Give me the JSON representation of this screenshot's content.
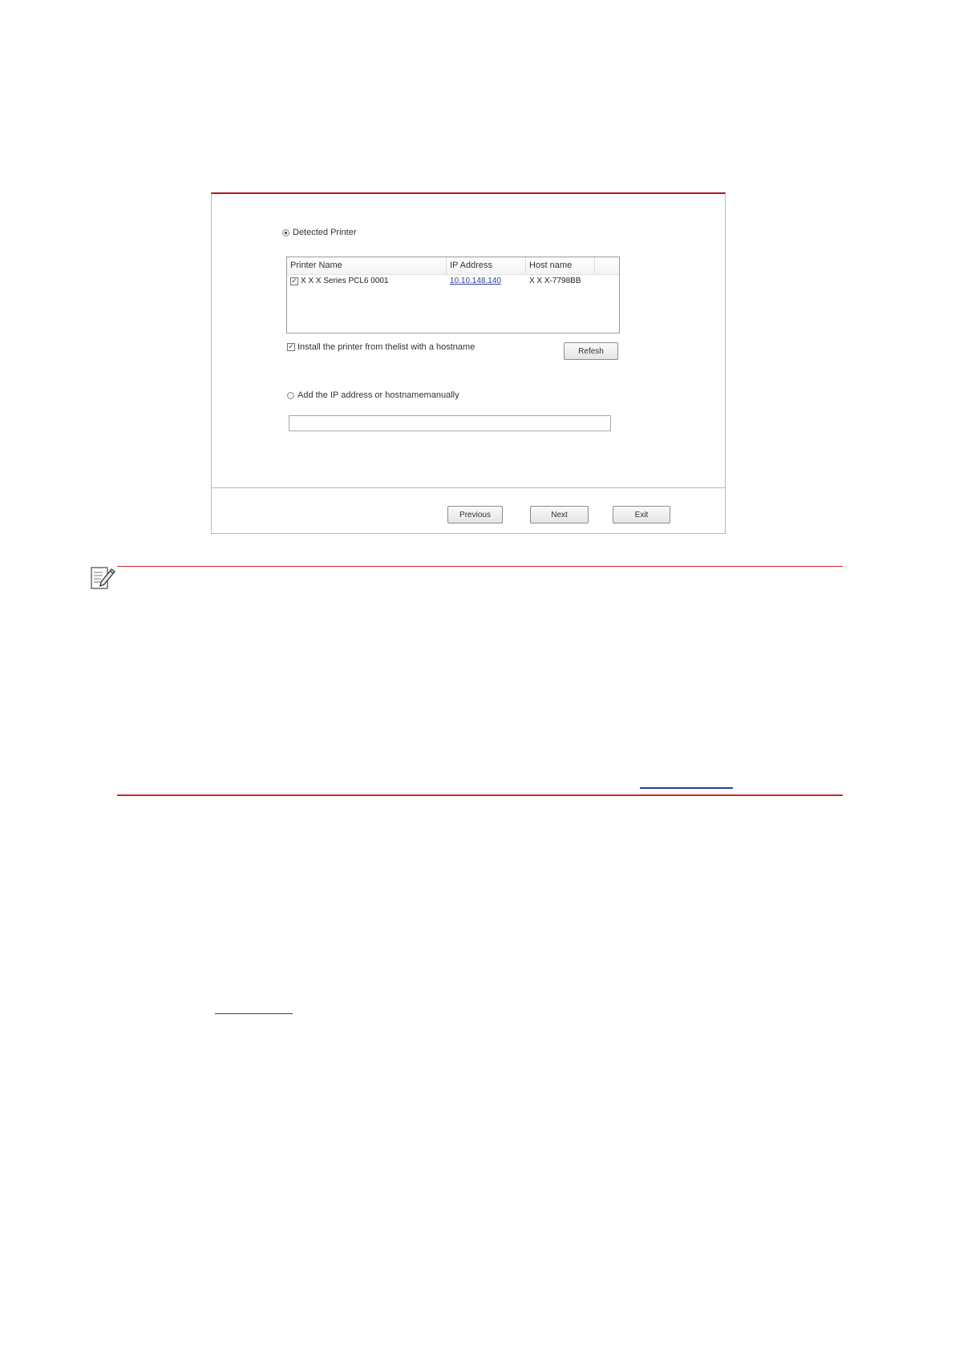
{
  "dialog": {
    "detected_radio_label": "Detected Printer",
    "table": {
      "columns": [
        "Printer Name",
        "IP Address",
        "Host name"
      ],
      "rows": [
        {
          "printer_name": "X X X  Series PCL6 0001",
          "ip_address": "10.10.148.140",
          "host_name": "X X X-7798BB"
        }
      ]
    },
    "install_hostname_label": "Install the printer from thelist with a hostname",
    "refresh_label": "Refesh",
    "manual_radio_label": "Add the IP address or hostnamemanually",
    "manual_input_value": "",
    "buttons": {
      "previous": "Previous",
      "next": "Next",
      "exit": "Exit"
    }
  },
  "icons": {
    "note": "note-pencil-icon"
  },
  "colors": {
    "accent_red": "#cc2a2a",
    "link_blue": "#2b3ea0"
  }
}
